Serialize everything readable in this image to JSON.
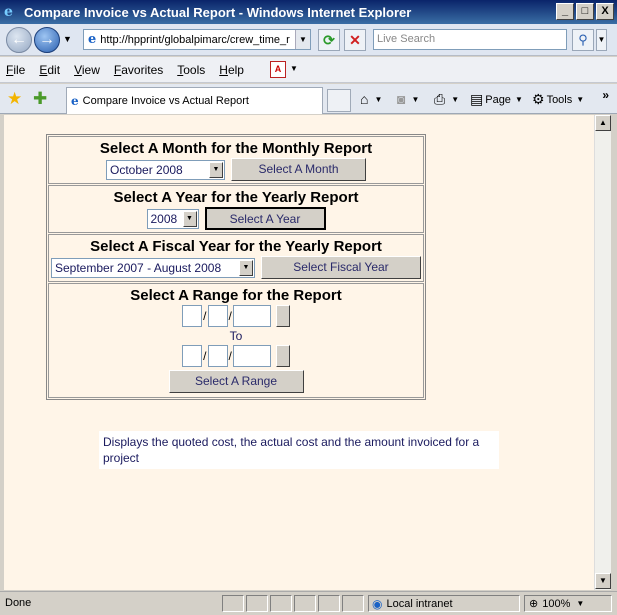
{
  "window": {
    "title": "Compare Invoice vs Actual Report - Windows Internet Explorer",
    "controls": [
      "_",
      "□",
      "X"
    ]
  },
  "address_bar": {
    "url": "http://hpprint/globalpimarc/crew_time_r",
    "search_placeholder": "Live Search"
  },
  "menu": {
    "items": [
      "File",
      "Edit",
      "View",
      "Favorites",
      "Tools",
      "Help"
    ]
  },
  "tab": {
    "label": "Compare Invoice vs Actual Report"
  },
  "command_bar": {
    "page_label": "Page",
    "tools_label": "Tools"
  },
  "report": {
    "monthly": {
      "heading": "Select A Month for the Monthly Report",
      "selected": "October 2008",
      "button": "Select A Month"
    },
    "yearly": {
      "heading": "Select A Year for the Yearly Report",
      "selected": "2008",
      "button": "Select A Year"
    },
    "fiscal": {
      "heading": "Select A Fiscal Year for the Yearly Report",
      "selected": "September 2007 - August 2008",
      "button": "Select Fiscal Year"
    },
    "range": {
      "heading": "Select A Range for the Report",
      "to_label": "To",
      "button": "Select A Range"
    },
    "description": "Displays the quoted cost, the actual cost and the amount invoiced for a project"
  },
  "status": {
    "text": "Done",
    "zone": "Local intranet",
    "zoom": "100%"
  }
}
